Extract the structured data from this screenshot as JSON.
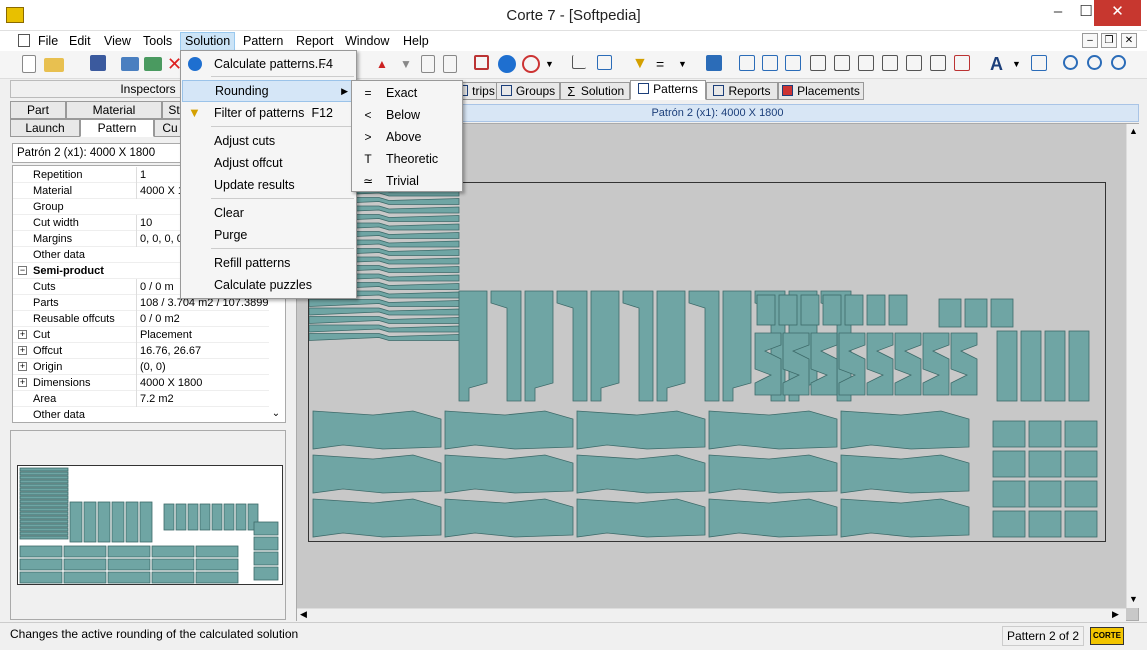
{
  "window": {
    "title": "Corte 7 - [Softpedia]",
    "minimize": "–",
    "maximize": "☐",
    "close": "✕"
  },
  "menubar": {
    "items": [
      "File",
      "Edit",
      "View",
      "Tools",
      "Solution",
      "Pattern",
      "Report",
      "Window",
      "Help"
    ],
    "active": "Solution"
  },
  "left_panel": {
    "inspectors_tab": "Inspectors",
    "tabs_row1": [
      "Part",
      "Material",
      "St"
    ],
    "tabs_row2": [
      "Launch",
      "Pattern",
      "Cu"
    ],
    "selected_tab": "Pattern",
    "header": "Patrón 2 (x1): 4000 X 1800",
    "properties": [
      {
        "key": "Repetition",
        "value": "1"
      },
      {
        "key": "Material",
        "value": "4000 X 18"
      },
      {
        "key": "Group",
        "value": ""
      },
      {
        "key": "Cut width",
        "value": "10"
      },
      {
        "key": "Margins",
        "value": "0, 0, 0, 0"
      },
      {
        "key": "Other data",
        "value": ""
      },
      {
        "key": "Semi-product",
        "value": "",
        "section": true
      },
      {
        "key": "Cuts",
        "value": "0 / 0 m"
      },
      {
        "key": "Parts",
        "value": "108 / 3.704 m2 / 107.3899"
      },
      {
        "key": "Reusable offcuts",
        "value": "0 / 0 m2"
      },
      {
        "key": "Cut",
        "value": "Placement",
        "expandable": true
      },
      {
        "key": "Offcut",
        "value": "16.76, 26.67",
        "expandable": true
      },
      {
        "key": "Origin",
        "value": "(0, 0)",
        "expandable": true
      },
      {
        "key": "Dimensions",
        "value": "4000 X 1800",
        "expandable": true
      },
      {
        "key": "Area",
        "value": "7.2 m2"
      },
      {
        "key": "Other data",
        "value": ""
      }
    ]
  },
  "main_tabs": [
    {
      "label": "trips",
      "icon": "strips-icon"
    },
    {
      "label": "Groups",
      "icon": "groups-icon"
    },
    {
      "label": "Solution",
      "icon": "sigma-icon"
    },
    {
      "label": "Patterns",
      "icon": "patterns-icon",
      "selected": true
    },
    {
      "label": "Reports",
      "icon": "reports-icon"
    },
    {
      "label": "Placements",
      "icon": "placements-icon"
    }
  ],
  "pattern_bar": "Patrón 2 (x1): 4000 X 1800",
  "solution_menu": {
    "items": [
      {
        "label": "Calculate patterns...",
        "accel": "F4",
        "icon": "play-icon"
      },
      {
        "label": "Rounding",
        "submenu": true,
        "hover": true
      },
      {
        "label": "Filter of patterns",
        "accel": "F12",
        "icon": "filter-icon"
      },
      {
        "label": "Adjust cuts"
      },
      {
        "label": "Adjust offcut"
      },
      {
        "label": "Update results"
      },
      {
        "label": "Clear"
      },
      {
        "label": "Purge"
      },
      {
        "label": "Refill patterns"
      },
      {
        "label": "Calculate puzzles"
      }
    ]
  },
  "rounding_menu": {
    "items": [
      {
        "label": "Exact",
        "symbol": "="
      },
      {
        "label": "Below",
        "symbol": "<"
      },
      {
        "label": "Above",
        "symbol": ">"
      },
      {
        "label": "Theoretic",
        "symbol": "T"
      },
      {
        "label": "Trivial",
        "symbol": "≃"
      }
    ]
  },
  "status": {
    "text": "Changes the active rounding of the calculated solution",
    "page": "Pattern 2 of 2",
    "logo": "CORTE"
  },
  "colors": {
    "part_fill": "#6fa5a4",
    "part_stroke": "#3d6a69",
    "menu_hover": "#d5e6f7",
    "close_red": "#c7372f"
  }
}
